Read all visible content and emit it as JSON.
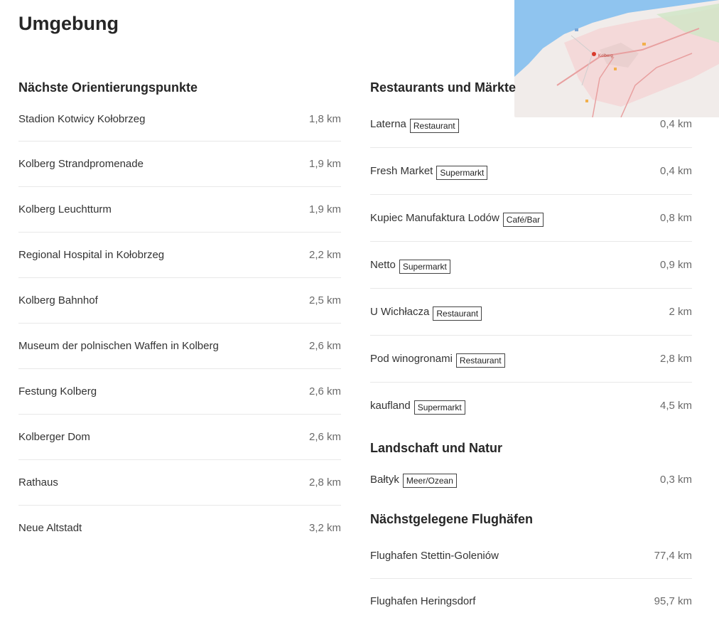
{
  "page": {
    "title": "Umgebung"
  },
  "landmarks": {
    "title": "Nächste Orientierungspunkte",
    "items": [
      {
        "name": "Stadion Kotwicy Kołobrzeg",
        "distance": "1,8 km"
      },
      {
        "name": "Kolberg Strandpromenade",
        "distance": "1,9 km"
      },
      {
        "name": "Kolberg Leuchtturm",
        "distance": "1,9 km"
      },
      {
        "name": "Regional Hospital in Kołobrzeg",
        "distance": "2,2 km"
      },
      {
        "name": "Kolberg Bahnhof",
        "distance": "2,5 km"
      },
      {
        "name": "Museum der polnischen Waffen in Kolberg",
        "distance": "2,6 km"
      },
      {
        "name": "Festung Kolberg",
        "distance": "2,6 km"
      },
      {
        "name": "Kolberger Dom",
        "distance": "2,6 km"
      },
      {
        "name": "Rathaus",
        "distance": "2,8 km"
      },
      {
        "name": "Neue Altstadt",
        "distance": "3,2 km"
      }
    ]
  },
  "restaurants": {
    "title": "Restaurants und Märkte",
    "items": [
      {
        "name": "Laterna",
        "type": "Restaurant",
        "distance": "0,4 km"
      },
      {
        "name": "Fresh Market",
        "type": "Supermarkt",
        "distance": "0,4 km"
      },
      {
        "name": "Kupiec Manufaktura Lodów",
        "type": "Café/Bar",
        "distance": "0,8 km"
      },
      {
        "name": "Netto",
        "type": "Supermarkt",
        "distance": "0,9 km"
      },
      {
        "name": "U Wichłacza",
        "type": "Restaurant",
        "distance": "2 km"
      },
      {
        "name": "Pod winogronami",
        "type": "Restaurant",
        "distance": "2,8 km"
      },
      {
        "name": "kaufland",
        "type": "Supermarkt",
        "distance": "4,5 km"
      }
    ]
  },
  "nature": {
    "title": "Landschaft und Natur",
    "items": [
      {
        "name": "Bałtyk",
        "type": "Meer/Ozean",
        "distance": "0,3 km"
      }
    ]
  },
  "airports": {
    "title": "Nächstgelegene Flughäfen",
    "items": [
      {
        "name": "Flughafen Stettin-Goleniów",
        "distance": "77,4 km"
      },
      {
        "name": "Flughafen Heringsdorf",
        "distance": "95,7 km"
      }
    ]
  },
  "map": {
    "town_label": "Kolberg",
    "colors": {
      "sea": "#8fc4ef",
      "land": "#f1ecea",
      "town": "#f4d3d3",
      "route": "#e8a0a0",
      "park": "#cfe6c6",
      "pin": "#d93a2b"
    }
  }
}
